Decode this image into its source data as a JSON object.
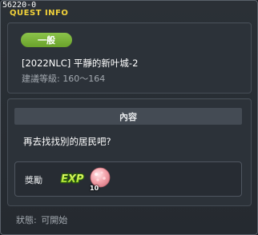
{
  "window": {
    "id_label": "56220-0",
    "title": "QUEST INFO"
  },
  "quest": {
    "category_badge": "一般",
    "name": "[2022NLC] 平靜的新叶城-2",
    "level_requirement": "建議等級: 160～164"
  },
  "content": {
    "header": "內容",
    "text": "再去找找別的居民吧?"
  },
  "reward": {
    "label": "獎勵",
    "exp_icon": "exp-icon",
    "orb_icon": "pink-orb-icon",
    "orb_count": "10"
  },
  "status": {
    "label": "狀態:",
    "value": "可開始"
  },
  "colors": {
    "title": "#f2d23a",
    "badge": "#7ab33a",
    "panel": "#2c3239"
  }
}
